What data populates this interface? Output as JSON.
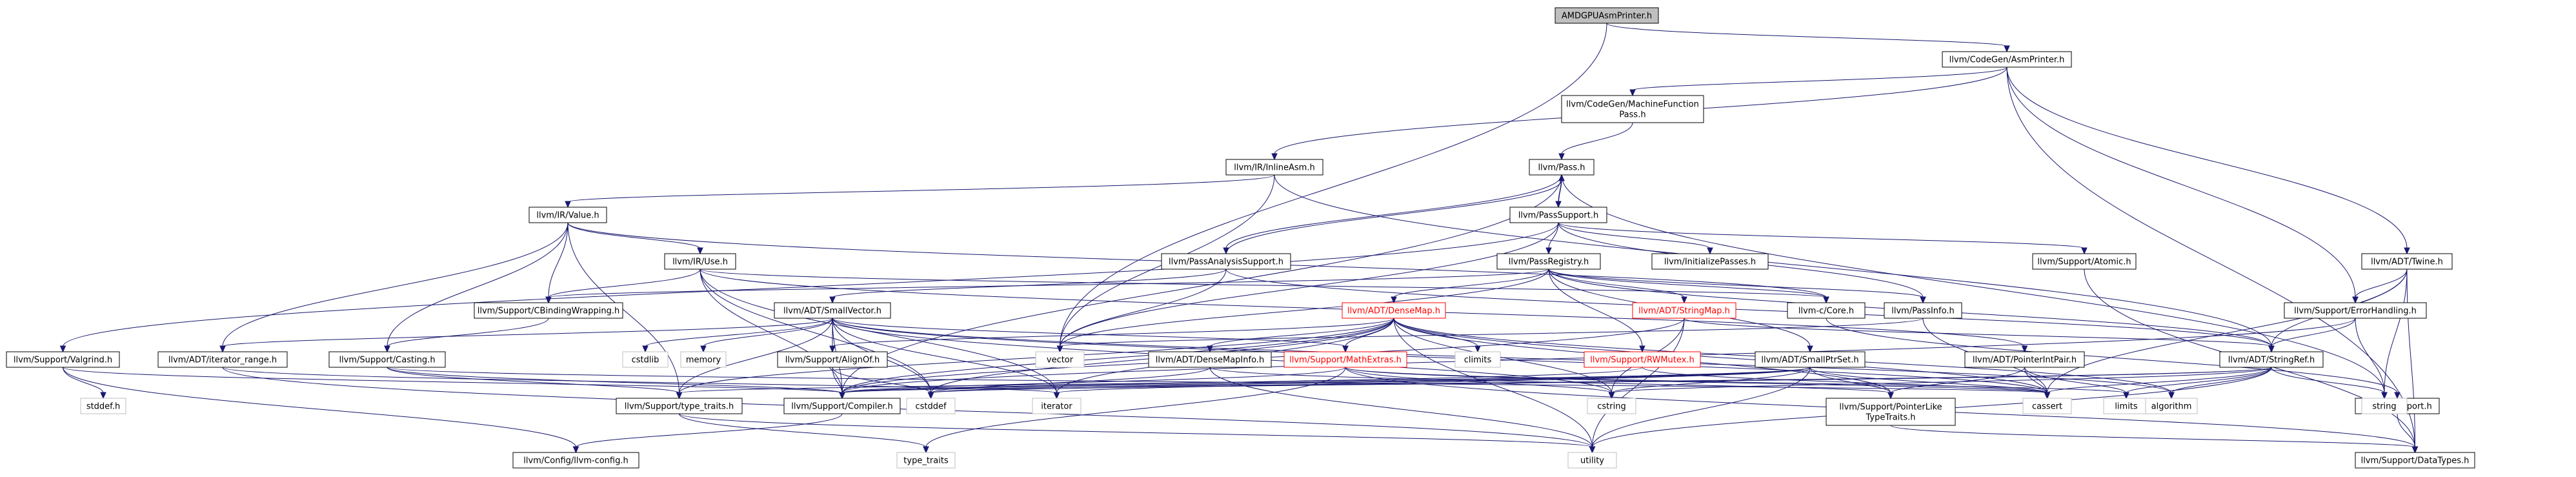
{
  "diagram": {
    "nodes": [
      {
        "id": "amdgpu",
        "label": "AMDGPUAsmPrinter.h",
        "kind": "root"
      },
      {
        "id": "asmprinter",
        "label": "llvm/CodeGen/AsmPrinter.h",
        "kind": "link"
      },
      {
        "id": "mfpass",
        "label": "llvm/CodeGen/MachineFunction\nPass.h",
        "kind": "link"
      },
      {
        "id": "inlineasm",
        "label": "llvm/IR/InlineAsm.h",
        "kind": "link"
      },
      {
        "id": "twine",
        "label": "llvm/ADT/Twine.h",
        "kind": "link"
      },
      {
        "id": "pass",
        "label": "llvm/Pass.h",
        "kind": "link"
      },
      {
        "id": "irvalue",
        "label": "llvm/IR/Value.h",
        "kind": "link"
      },
      {
        "id": "passsupport",
        "label": "llvm/PassSupport.h",
        "kind": "link"
      },
      {
        "id": "iruse",
        "label": "llvm/IR/Use.h",
        "kind": "link"
      },
      {
        "id": "passanalysis",
        "label": "llvm/PassAnalysisSupport.h",
        "kind": "link"
      },
      {
        "id": "passregistry",
        "label": "llvm/PassRegistry.h",
        "kind": "link"
      },
      {
        "id": "initpasses",
        "label": "llvm/InitializePasses.h",
        "kind": "link"
      },
      {
        "id": "atomic",
        "label": "llvm/Support/Atomic.h",
        "kind": "link"
      },
      {
        "id": "errorhandling",
        "label": "llvm/Support/ErrorHandling.h",
        "kind": "link"
      },
      {
        "id": "cbinding",
        "label": "llvm/Support/CBindingWrapping.h",
        "kind": "link"
      },
      {
        "id": "smallvector",
        "label": "llvm/ADT/SmallVector.h",
        "kind": "link"
      },
      {
        "id": "densemap",
        "label": "llvm/ADT/DenseMap.h",
        "kind": "red"
      },
      {
        "id": "stringmap",
        "label": "llvm/ADT/StringMap.h",
        "kind": "red"
      },
      {
        "id": "ccore",
        "label": "llvm-c/Core.h",
        "kind": "link"
      },
      {
        "id": "passinfo",
        "label": "llvm/PassInfo.h",
        "kind": "link"
      },
      {
        "id": "valgrind",
        "label": "llvm/Support/Valgrind.h",
        "kind": "link"
      },
      {
        "id": "iterrange",
        "label": "llvm/ADT/iterator_range.h",
        "kind": "link"
      },
      {
        "id": "casting",
        "label": "llvm/Support/Casting.h",
        "kind": "link"
      },
      {
        "id": "cstdlib",
        "label": "cstdlib",
        "kind": "plain"
      },
      {
        "id": "memory",
        "label": "memory",
        "kind": "plain"
      },
      {
        "id": "alignof",
        "label": "llvm/Support/AlignOf.h",
        "kind": "link"
      },
      {
        "id": "vector",
        "label": "vector",
        "kind": "plain"
      },
      {
        "id": "densemapinfo",
        "label": "llvm/ADT/DenseMapInfo.h",
        "kind": "link"
      },
      {
        "id": "mathextras",
        "label": "llvm/Support/MathExtras.h",
        "kind": "red"
      },
      {
        "id": "climits",
        "label": "climits",
        "kind": "plain"
      },
      {
        "id": "rwmutex",
        "label": "llvm/Support/RWMutex.h",
        "kind": "red"
      },
      {
        "id": "smallptrset",
        "label": "llvm/ADT/SmallPtrSet.h",
        "kind": "link"
      },
      {
        "id": "pointerintpair",
        "label": "llvm/ADT/PointerIntPair.h",
        "kind": "link"
      },
      {
        "id": "stringref",
        "label": "llvm/ADT/StringRef.h",
        "kind": "link"
      },
      {
        "id": "csupport",
        "label": "llvm-c/Support.h",
        "kind": "link"
      },
      {
        "id": "stddef",
        "label": "stddef.h",
        "kind": "plain"
      },
      {
        "id": "typetraits_h",
        "label": "llvm/Support/type_traits.h",
        "kind": "link"
      },
      {
        "id": "compiler",
        "label": "llvm/Support/Compiler.h",
        "kind": "link"
      },
      {
        "id": "cstddef",
        "label": "cstddef",
        "kind": "plain"
      },
      {
        "id": "iterator",
        "label": "iterator",
        "kind": "plain"
      },
      {
        "id": "cstring",
        "label": "cstring",
        "kind": "plain"
      },
      {
        "id": "ptrlike",
        "label": "llvm/Support/PointerLike\nTypeTraits.h",
        "kind": "link"
      },
      {
        "id": "cassert",
        "label": "cassert",
        "kind": "plain"
      },
      {
        "id": "limits",
        "label": "limits",
        "kind": "plain"
      },
      {
        "id": "algorithm",
        "label": "algorithm",
        "kind": "plain"
      },
      {
        "id": "string",
        "label": "string",
        "kind": "plain"
      },
      {
        "id": "llvmconfig",
        "label": "llvm/Config/llvm-config.h",
        "kind": "link"
      },
      {
        "id": "type_traits",
        "label": "type_traits",
        "kind": "plain"
      },
      {
        "id": "utility",
        "label": "utility",
        "kind": "plain"
      },
      {
        "id": "datatypes",
        "label": "llvm/Support/DataTypes.h",
        "kind": "link"
      }
    ],
    "edges": [
      [
        "amdgpu",
        "asmprinter"
      ],
      [
        "amdgpu",
        "vector"
      ],
      [
        "asmprinter",
        "mfpass"
      ],
      [
        "asmprinter",
        "inlineasm"
      ],
      [
        "asmprinter",
        "twine"
      ],
      [
        "asmprinter",
        "errorhandling"
      ],
      [
        "asmprinter",
        "datatypes"
      ],
      [
        "mfpass",
        "pass"
      ],
      [
        "inlineasm",
        "irvalue"
      ],
      [
        "inlineasm",
        "stringref"
      ],
      [
        "inlineasm",
        "vector"
      ],
      [
        "twine",
        "stringref"
      ],
      [
        "twine",
        "errorhandling"
      ],
      [
        "twine",
        "string"
      ],
      [
        "twine",
        "cassert"
      ],
      [
        "twine",
        "datatypes"
      ],
      [
        "pass",
        "passsupport"
      ],
      [
        "pass",
        "passanalysis"
      ],
      [
        "pass",
        "string"
      ],
      [
        "pass",
        "compiler"
      ],
      [
        "passsupport",
        "pass"
      ],
      [
        "passsupport",
        "passinfo"
      ],
      [
        "passsupport",
        "passregistry"
      ],
      [
        "passsupport",
        "initpasses"
      ],
      [
        "passsupport",
        "atomic"
      ],
      [
        "passsupport",
        "valgrind"
      ],
      [
        "passsupport",
        "vector"
      ],
      [
        "passanalysis",
        "pass"
      ],
      [
        "passanalysis",
        "smallvector"
      ],
      [
        "passanalysis",
        "stringref"
      ],
      [
        "passanalysis",
        "vector"
      ],
      [
        "irvalue",
        "iruse"
      ],
      [
        "irvalue",
        "cbinding"
      ],
      [
        "irvalue",
        "casting"
      ],
      [
        "irvalue",
        "iterrange"
      ],
      [
        "irvalue",
        "ccore"
      ],
      [
        "irvalue",
        "typetraits_h"
      ],
      [
        "iruse",
        "cbinding"
      ],
      [
        "iruse",
        "compiler"
      ],
      [
        "iruse",
        "ccore"
      ],
      [
        "iruse",
        "iterator"
      ],
      [
        "iruse",
        "pointerintpair"
      ],
      [
        "iruse",
        "cstddef"
      ],
      [
        "passregistry",
        "densemap"
      ],
      [
        "passregistry",
        "stringmap"
      ],
      [
        "passregistry",
        "smallptrset"
      ],
      [
        "passregistry",
        "rwmutex"
      ],
      [
        "passregistry",
        "cbinding"
      ],
      [
        "passregistry",
        "ccore"
      ],
      [
        "passregistry",
        "passinfo"
      ],
      [
        "passregistry",
        "vector"
      ],
      [
        "passregistry",
        "stringref"
      ],
      [
        "atomic",
        "datatypes"
      ],
      [
        "errorhandling",
        "stringref"
      ],
      [
        "errorhandling",
        "compiler"
      ],
      [
        "errorhandling",
        "string"
      ],
      [
        "cbinding",
        "casting"
      ],
      [
        "casting",
        "compiler"
      ],
      [
        "casting",
        "typetraits_h"
      ],
      [
        "casting",
        "cassert"
      ],
      [
        "smallvector",
        "alignof"
      ],
      [
        "smallvector",
        "compiler"
      ],
      [
        "smallvector",
        "mathextras"
      ],
      [
        "smallvector",
        "typetraits_h"
      ],
      [
        "smallvector",
        "algorithm"
      ],
      [
        "smallvector",
        "cassert"
      ],
      [
        "smallvector",
        "cstddef"
      ],
      [
        "smallvector",
        "cstdlib"
      ],
      [
        "smallvector",
        "cstring"
      ],
      [
        "smallvector",
        "iterator"
      ],
      [
        "smallvector",
        "memory"
      ],
      [
        "smallvector",
        "iterrange"
      ],
      [
        "densemap",
        "densemapinfo"
      ],
      [
        "densemap",
        "mathextras"
      ],
      [
        "densemap",
        "ptrlike"
      ],
      [
        "densemap",
        "typetraits_h"
      ],
      [
        "densemap",
        "algorithm"
      ],
      [
        "densemap",
        "cassert"
      ],
      [
        "densemap",
        "climits"
      ],
      [
        "densemap",
        "cstddef"
      ],
      [
        "densemap",
        "cstring"
      ],
      [
        "densemap",
        "iterator"
      ],
      [
        "densemap",
        "utility"
      ],
      [
        "densemap",
        "alignof"
      ],
      [
        "densemap",
        "compiler"
      ],
      [
        "stringmap",
        "stringref"
      ],
      [
        "stringmap",
        "compiler"
      ],
      [
        "stringmap",
        "cstring"
      ],
      [
        "stringmap",
        "utility"
      ],
      [
        "ccore",
        "csupport"
      ],
      [
        "passinfo",
        "vector"
      ],
      [
        "passinfo",
        "cassert"
      ],
      [
        "valgrind",
        "llvmconfig"
      ],
      [
        "valgrind",
        "compiler"
      ],
      [
        "valgrind",
        "stddef"
      ],
      [
        "iterrange",
        "utility"
      ],
      [
        "iterrange",
        "iterator"
      ],
      [
        "alignof",
        "compiler"
      ],
      [
        "alignof",
        "cstddef"
      ],
      [
        "densemapinfo",
        "ptrlike"
      ],
      [
        "densemapinfo",
        "cstddef"
      ],
      [
        "densemapinfo",
        "utility"
      ],
      [
        "mathextras",
        "compiler"
      ],
      [
        "mathextras",
        "datatypes"
      ],
      [
        "mathextras",
        "cassert"
      ],
      [
        "mathextras",
        "cstring"
      ],
      [
        "mathextras",
        "type_traits"
      ],
      [
        "mathextras",
        "limits"
      ],
      [
        "rwmutex",
        "compiler"
      ],
      [
        "rwmutex",
        "cassert"
      ],
      [
        "smallptrset",
        "ptrlike"
      ],
      [
        "smallptrset",
        "compiler"
      ],
      [
        "smallptrset",
        "cassert"
      ],
      [
        "smallptrset",
        "cstddef"
      ],
      [
        "smallptrset",
        "cstring"
      ],
      [
        "smallptrset",
        "iterator"
      ],
      [
        "smallptrset",
        "utility"
      ],
      [
        "smallptrset",
        "typetraits_h"
      ],
      [
        "pointerintpair",
        "ptrlike"
      ],
      [
        "pointerintpair",
        "cassert"
      ],
      [
        "pointerintpair",
        "limits"
      ],
      [
        "stringref",
        "compiler"
      ],
      [
        "stringref",
        "algorithm"
      ],
      [
        "stringref",
        "cassert"
      ],
      [
        "stringref",
        "cstddef"
      ],
      [
        "stringref",
        "cstring"
      ],
      [
        "stringref",
        "limits"
      ],
      [
        "stringref",
        "string"
      ],
      [
        "stringref",
        "utility"
      ],
      [
        "csupport",
        "datatypes"
      ],
      [
        "typetraits_h",
        "utility"
      ],
      [
        "typetraits_h",
        "type_traits"
      ],
      [
        "compiler",
        "llvmconfig"
      ],
      [
        "ptrlike",
        "datatypes"
      ]
    ]
  }
}
